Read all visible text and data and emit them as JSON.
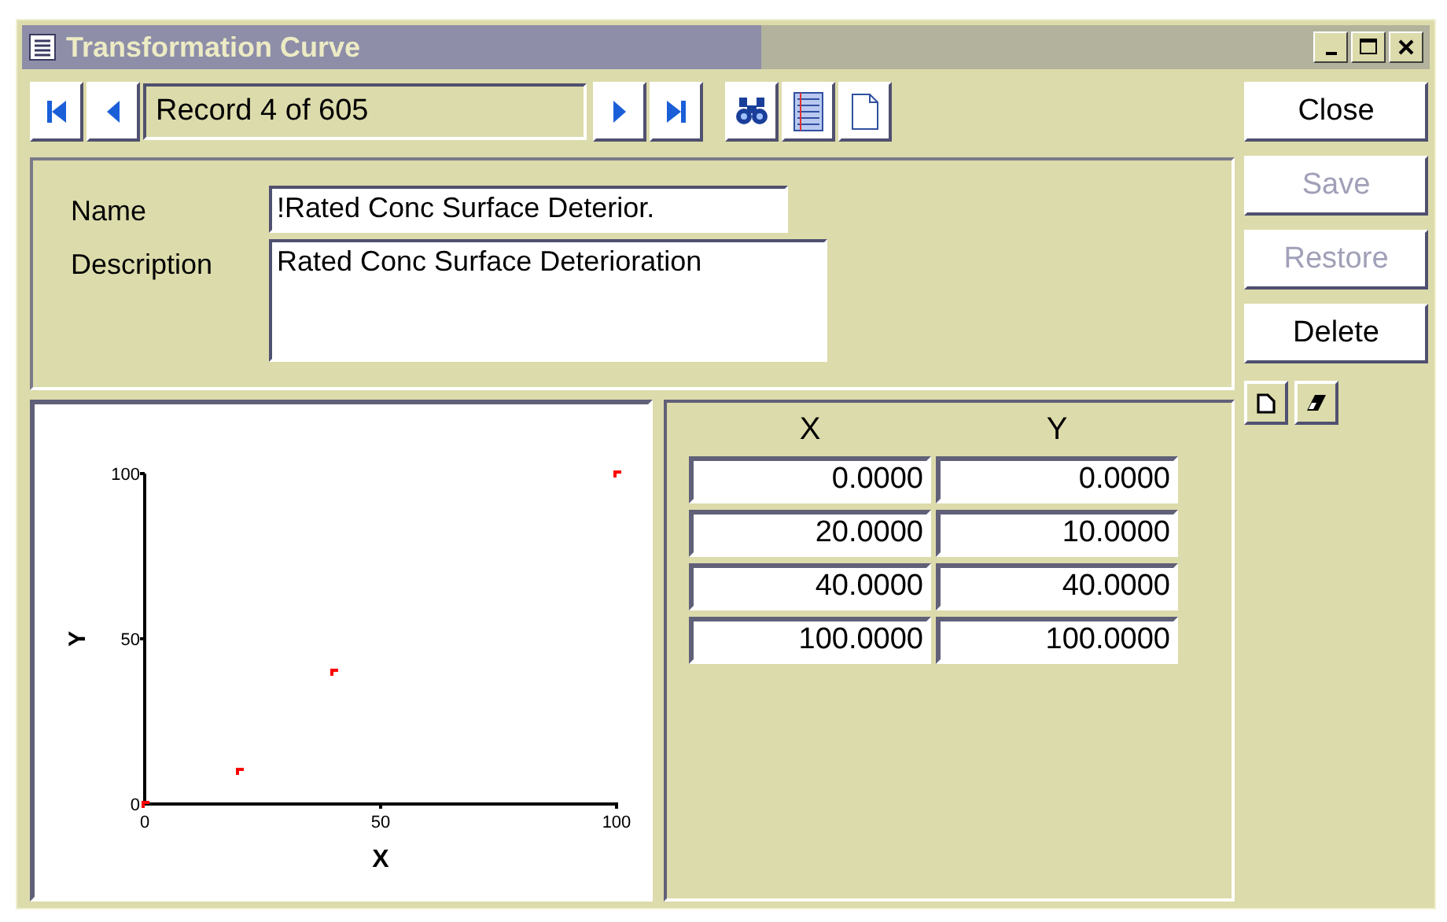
{
  "window": {
    "title": "Transformation Curve"
  },
  "navigator": {
    "record": "Record 4 of 605"
  },
  "form": {
    "fields": [
      {
        "label": "Name",
        "value": "!Rated Conc Surface Deterior.",
        "kind": "line"
      },
      {
        "label": "Description",
        "value": "Rated Conc Surface Deterioration",
        "kind": "area"
      }
    ]
  },
  "chart": {
    "chart_data": {
      "type": "scatter",
      "xlabel": "X",
      "ylabel": "Y",
      "x": [
        0,
        20,
        40,
        100
      ],
      "series": [
        {
          "color": "#ff0000",
          "values": [
            0,
            10,
            40,
            100
          ]
        }
      ],
      "xlim": [
        0,
        100
      ],
      "ylim": [
        0,
        100
      ],
      "xticks": [
        0,
        50,
        100
      ],
      "yticks": [
        0,
        50,
        100
      ]
    }
  },
  "table": {
    "columns": [
      "X",
      "Y"
    ],
    "rows": [
      [
        "0.0000",
        "0.0000"
      ],
      [
        "20.0000",
        "10.0000"
      ],
      [
        "40.0000",
        "40.0000"
      ],
      [
        "100.0000",
        "100.0000"
      ]
    ]
  },
  "actions": [
    {
      "label": "Close",
      "disabled": false
    },
    {
      "label": "Save",
      "disabled": true
    },
    {
      "label": "Restore",
      "disabled": true
    },
    {
      "label": "Delete",
      "disabled": false
    }
  ]
}
